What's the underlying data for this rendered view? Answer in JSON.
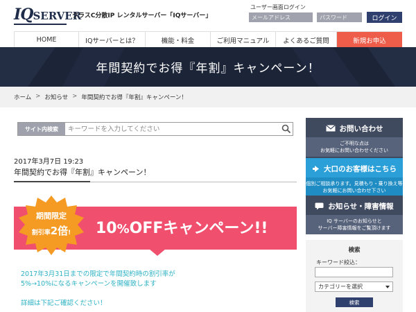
{
  "header": {
    "logo_iq": "IQ",
    "logo_server": "SERVER",
    "tagline": "クラスC分散IP レンタルサーバー「IQサーバー」",
    "login": {
      "title": "ユーザー画面ログイン",
      "email_placeholder": "メールアドレス",
      "password_placeholder": "パスワード",
      "button_label": "ログイン"
    }
  },
  "nav": {
    "items": [
      {
        "label": "HOME"
      },
      {
        "label": "IQサーバーとは？"
      },
      {
        "label": "機能・料金"
      },
      {
        "label": "ご利用マニュアル"
      },
      {
        "label": "よくあるご質問"
      },
      {
        "label": "新規お申込"
      }
    ]
  },
  "hero": {
    "title": "年間契約でお得『年割』キャンペーン！"
  },
  "breadcrumb": {
    "items": [
      "ホーム",
      "お知らせ",
      "年間契約でお得『年割』キャンペーン！"
    ],
    "separator": ">"
  },
  "search": {
    "label": "サイト内検索",
    "placeholder": "キーワードを入力してください"
  },
  "post": {
    "date": "2017年3月7日 19:23",
    "title": "年間契約でお得『年割』キャンペーン！",
    "banner": {
      "burst_line1": "期間限定",
      "burst_line2_prefix": "割引率",
      "burst_line2_num": "2倍",
      "burst_line2_suffix": "!",
      "main_num": "10",
      "main_pct": "%",
      "main_rest": "OFFキャンペーン!!"
    },
    "body_lines": [
      "2017年3月31日までの限定で年間契約時の割引率が",
      "5%→10%になるキャンペーンを開催致します",
      "詳細は下記ご確認ください！"
    ]
  },
  "sidebar": {
    "contact": {
      "title": "お問い合わせ",
      "line1": "ご不明な点は",
      "line2": "お気軽にお問い合わせください"
    },
    "large": {
      "title": "大口のお客様はこちら",
      "line1": "個別ご相談承ります。見積もり・乗り換え等",
      "line2": "お気軽にお問い合わせ下さい"
    },
    "info": {
      "title": "お知らせ・障害情報",
      "line1": "IQ サーバーのお知らせと",
      "line2": "サーバー障害情報をご覧頂けます"
    },
    "search": {
      "title": "検索",
      "keyword_label": "キーワード絞込：",
      "category_selected": "カテゴリーを選択",
      "button_label": "検索"
    }
  },
  "colors": {
    "navy": "#1c2438",
    "accent_red": "#ee5d4a",
    "banner_pink": "#f0506e",
    "burst_orange": "#f59a23",
    "sidebar_blue": "#2a9fd8",
    "sidebar_dark": "#404a5f",
    "body_teal": "#2ab1c4"
  }
}
